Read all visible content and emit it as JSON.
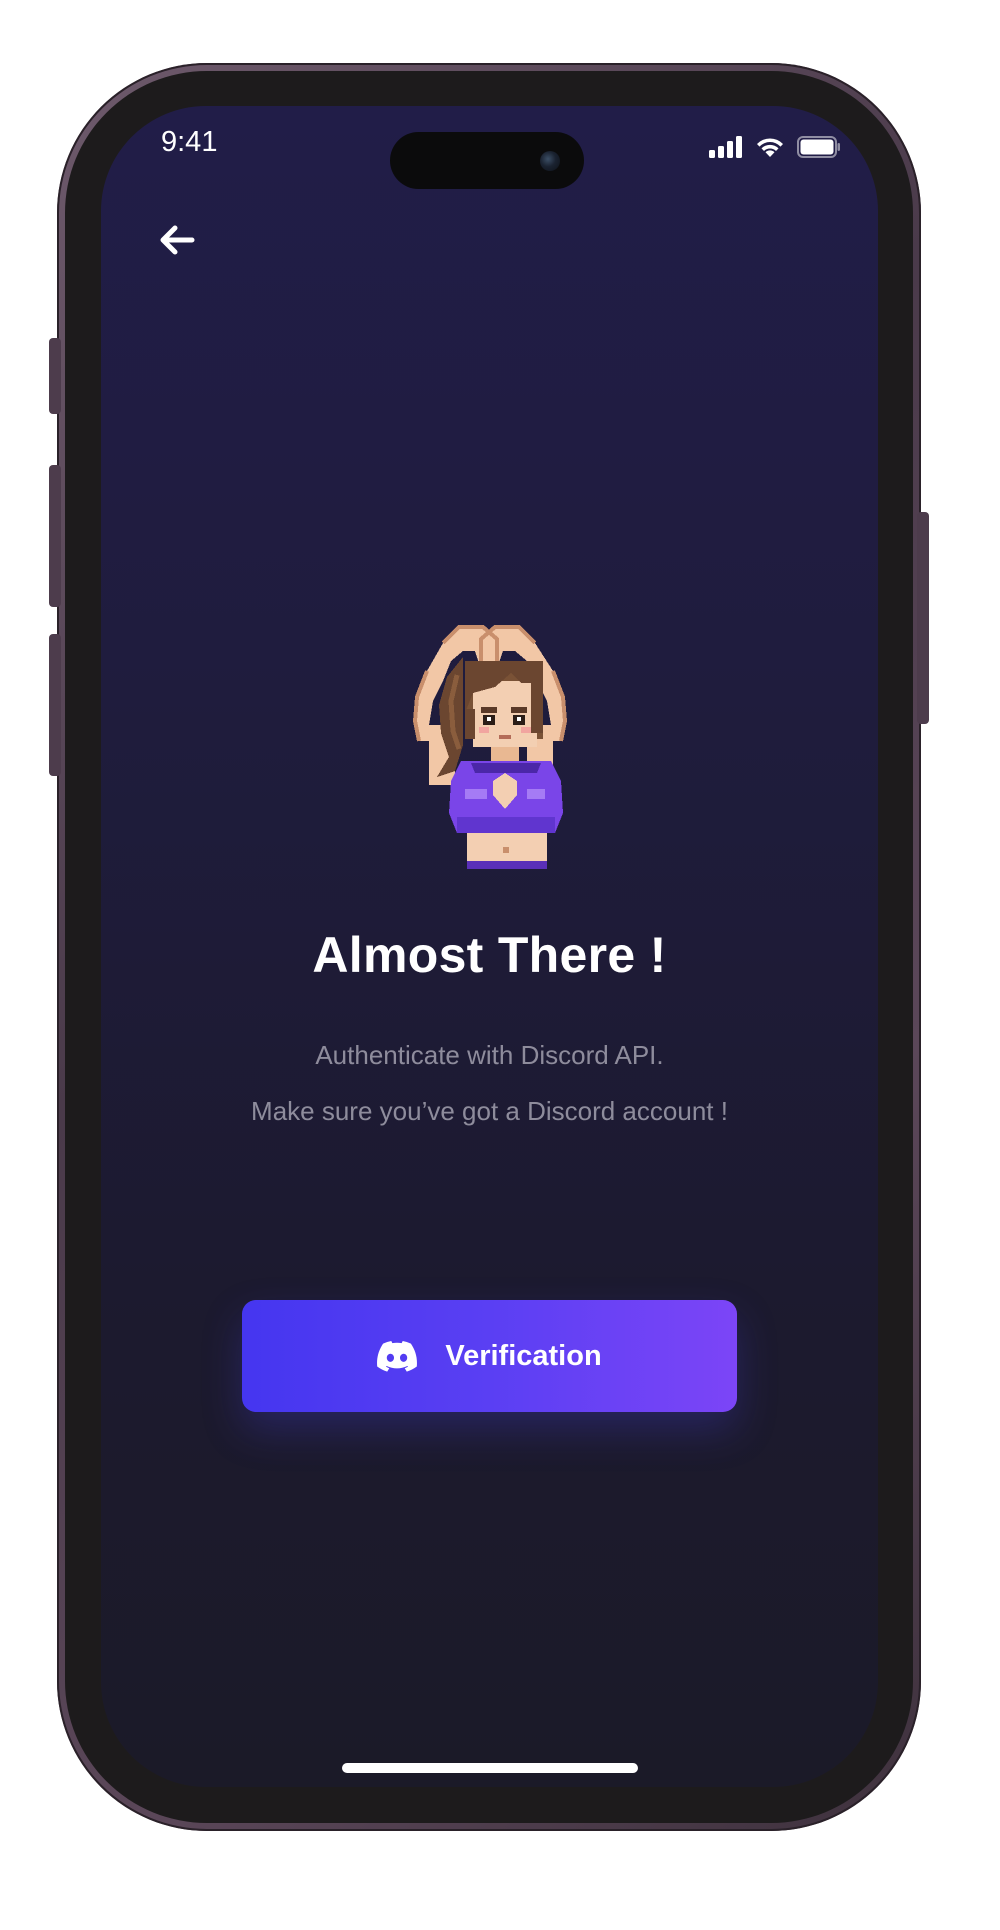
{
  "status_bar": {
    "time": "9:41"
  },
  "header": {
    "back_icon": "arrow-left-icon"
  },
  "main": {
    "title": "Almost There !",
    "subtitle_line1": "Authenticate with Discord API.",
    "subtitle_line2": "Make sure you’ve got a Discord account !",
    "illustration": "pixel-art-girl-heart-pose"
  },
  "verify_button": {
    "label": "Verification",
    "icon": "discord-icon"
  },
  "colors": {
    "background_top": "#211d48",
    "background_bottom": "#1b1a28",
    "button_start": "#4536f0",
    "button_end": "#7c45f7",
    "subtitle": "#8e8c9c"
  }
}
